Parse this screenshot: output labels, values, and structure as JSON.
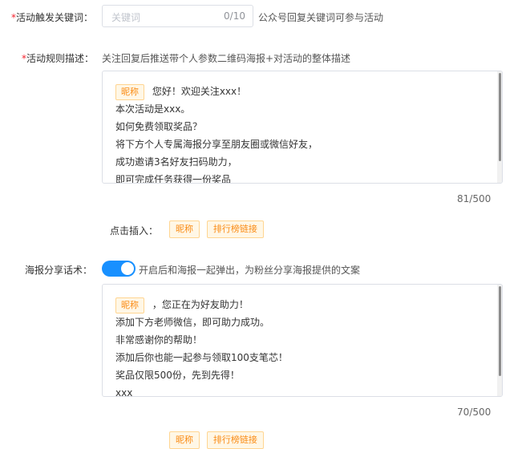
{
  "keyword": {
    "label": "活动触发关键词：",
    "placeholder": "关键词",
    "counter": "0/10",
    "hint": "公众号回复关键词可参与活动"
  },
  "rules": {
    "label": "活动规则描述：",
    "description": "关注回复后推送带个人参数二维码海报+对活动的整体描述",
    "nickname_tag": "昵称",
    "first_line_rest": "您好！欢迎关注xxx！",
    "lines": [
      "本次活动是xxx。",
      "如何免费领取奖品？",
      "将下方个人专属海报分享至朋友圈或微信好友，",
      "成功邀请3名好友扫码助力，",
      "即可完成任务获得一份奖品"
    ],
    "counter": "81/500"
  },
  "insert": {
    "label": "点击插入：",
    "tags": [
      "昵称",
      "排行榜链接"
    ]
  },
  "share": {
    "label": "海报分享话术：",
    "toggle_on": true,
    "hint": "开启后和海报一起弹出，为粉丝分享海报提供的文案",
    "nickname_tag": "昵称",
    "first_line_rest": "，您正在为好友助力！",
    "lines": [
      "添加下方老师微信，即可助力成功。",
      "非常感谢你的帮助！",
      "添加后你也能一起参与领取100支笔芯！",
      "奖品仅限500份，先到先得！",
      "xxx"
    ],
    "counter": "70/500"
  },
  "insert2": {
    "tags": [
      "昵称",
      "排行榜链接"
    ]
  },
  "colors": {
    "required": "#f5222d",
    "accent": "#1890ff",
    "tag_text": "#fa8c16"
  }
}
